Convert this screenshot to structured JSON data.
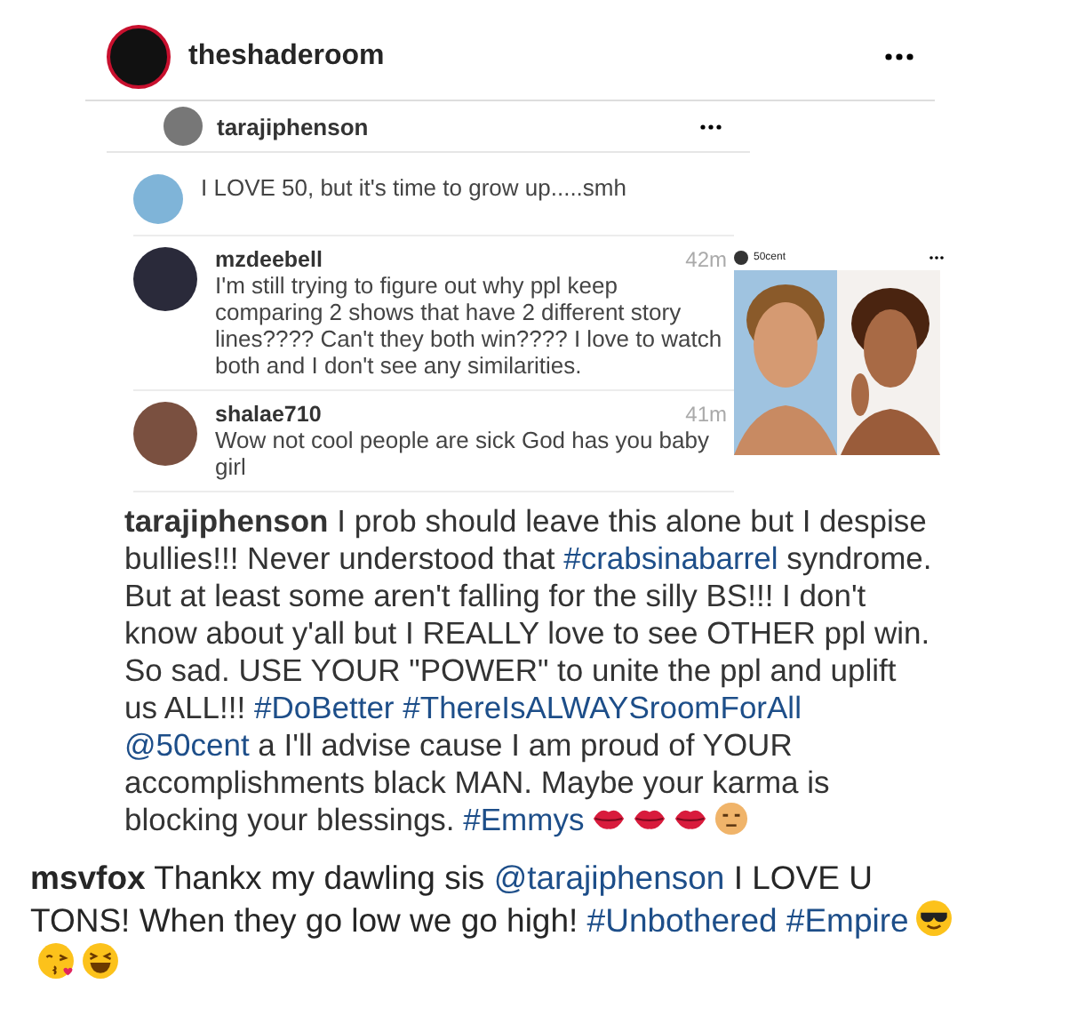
{
  "post": {
    "username": "theshaderoom"
  },
  "inner_post": {
    "username": "tarajiphenson",
    "comments": [
      {
        "text": "I LOVE 50, but it's time to grow up.....smh"
      },
      {
        "username": "mzdeebell",
        "text": "I'm still trying to figure out why ppl keep comparing 2 shows that have 2 different story lines???? Can't they both win???? I love to watch both and I don't see any similarities.",
        "time": "42m"
      },
      {
        "username": "shalae710",
        "text": "Wow not cool people are sick God has you baby girl",
        "time": "41m"
      }
    ],
    "shared_post": {
      "username": "50cent",
      "kind": "picture"
    },
    "caption": [
      {
        "kind": "user",
        "text": "tarajiphenson"
      },
      {
        "kind": "text",
        "text": " I prob should leave this alone but I despise bullies!!! Never understood that "
      },
      {
        "kind": "tag",
        "text": "#crabsinabarrel"
      },
      {
        "kind": "text",
        "text": " syndrome.  But at least some aren't falling for the silly BS!!! I don't know about y'all but I REALLY love to see OTHER ppl win. So sad.  USE YOUR \"POWER\" to unite the ppl and uplift us ALL!!! "
      },
      {
        "kind": "tag",
        "text": "#DoBetter"
      },
      {
        "kind": "tag",
        "text": "#ThereIsALWAYSroomForAll"
      },
      {
        "kind": "tag",
        "text": "@50cent"
      },
      {
        "kind": "text",
        "text": " a I'll advise cause I am proud of YOUR accomplishments black MAN. Maybe your karma is blocking your blessings. "
      },
      {
        "kind": "tag",
        "text": "#Emmys"
      },
      {
        "kind": "lips"
      },
      {
        "kind": "lips"
      },
      {
        "kind": "lips"
      },
      {
        "kind": "unamused"
      }
    ]
  },
  "caption": [
    {
      "kind": "user",
      "text": "msvfox"
    },
    {
      "kind": "text",
      "text": " Thankx my dawling sis "
    },
    {
      "kind": "tag",
      "text": "@tarajiphenson"
    },
    {
      "kind": "text",
      "text": " I LOVE U TONS! When they go low we go high! "
    },
    {
      "kind": "tag",
      "text": "#Unbothered"
    },
    {
      "kind": "tag",
      "text": "#Empire"
    },
    {
      "kind": "sunglasses"
    },
    {
      "kind": "kiss"
    },
    {
      "kind": "laugh"
    }
  ]
}
